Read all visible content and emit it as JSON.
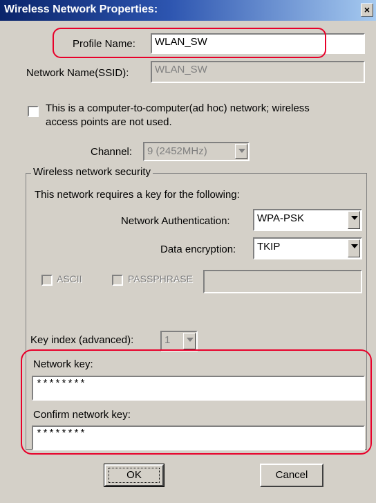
{
  "window": {
    "title": "Wireless Network Properties:",
    "close_label": "×"
  },
  "profile": {
    "label": "Profile Name:",
    "value": "WLAN_SW"
  },
  "ssid": {
    "label": "Network Name(SSID):",
    "value": "WLAN_SW"
  },
  "adhoc": {
    "label_line1": "This is a computer-to-computer(ad hoc) network; wireless",
    "label_line2": "access points are not used.",
    "checked": false
  },
  "channel": {
    "label": "Channel:",
    "value": "9  (2452MHz)"
  },
  "security": {
    "legend": "Wireless network security",
    "intro": "This network requires a key for the following:",
    "auth_label": "Network Authentication:",
    "auth_value": "WPA-PSK",
    "encryption_label": "Data encryption:",
    "encryption_value": "TKIP",
    "ascii_label": "ASCII",
    "passphrase_label": "PASSPHRASE",
    "key_index_label": "Key index (advanced):",
    "key_index_value": "1",
    "network_key_label": "Network key:",
    "network_key_value": "********",
    "confirm_key_label": "Confirm network key:",
    "confirm_key_value": "********"
  },
  "buttons": {
    "ok_label": "OK",
    "cancel_label": "Cancel"
  },
  "colors": {
    "highlight": "#e8002a",
    "titlebar": "#0a246a",
    "dialog_bg": "#d4d0c8"
  }
}
